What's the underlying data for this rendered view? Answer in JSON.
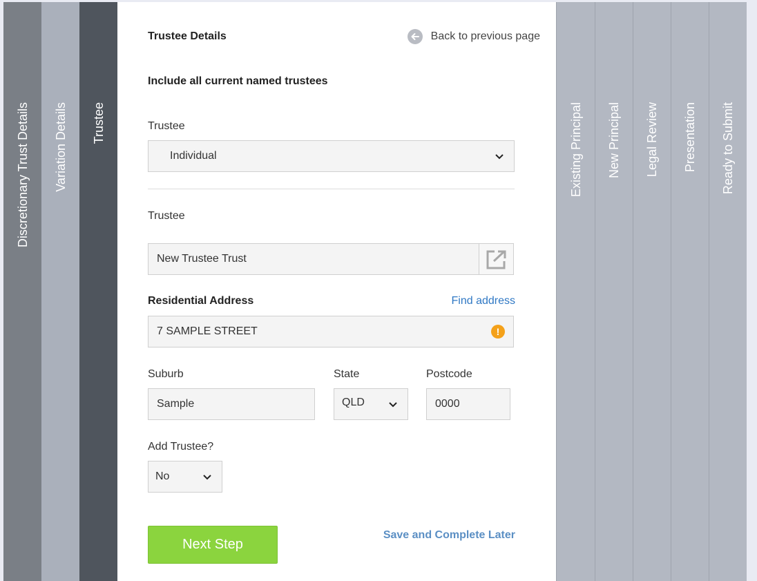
{
  "steps_left": [
    {
      "label": "Discretionary Trust Details",
      "color": "#7a7f86"
    },
    {
      "label": "Variation Details",
      "color": "#aab0bb"
    },
    {
      "label": "Trustee",
      "color": "#4f555d"
    }
  ],
  "steps_right": [
    {
      "label": "Existing Principal"
    },
    {
      "label": "New Principal"
    },
    {
      "label": "Legal Review"
    },
    {
      "label": "Presentation"
    },
    {
      "label": "Ready to Submit"
    }
  ],
  "header": {
    "title": "Trustee Details",
    "back_label": "Back to previous page"
  },
  "form": {
    "subtitle": "Include all current named trustees",
    "trustee_type_label": "Trustee",
    "trustee_type_value": "Individual",
    "trustee_name_label": "Trustee",
    "trustee_name_value": "New Trustee Trust",
    "address_label": "Residential Address",
    "find_address_link": "Find address",
    "address_value": "7 SAMPLE STREET",
    "suburb_label": "Suburb",
    "suburb_value": "Sample",
    "state_label": "State",
    "state_value": "QLD",
    "postcode_label": "Postcode",
    "postcode_value": "0000",
    "add_trustee_label": "Add Trustee?",
    "add_trustee_value": "No"
  },
  "actions": {
    "next_label": "Next Step",
    "save_later_label": "Save and Complete Later"
  },
  "colors": {
    "right_tab": "#b3b8c2",
    "accent_green": "#8bd43e",
    "link_blue": "#2f78c4",
    "warning": "#f4a11a"
  }
}
